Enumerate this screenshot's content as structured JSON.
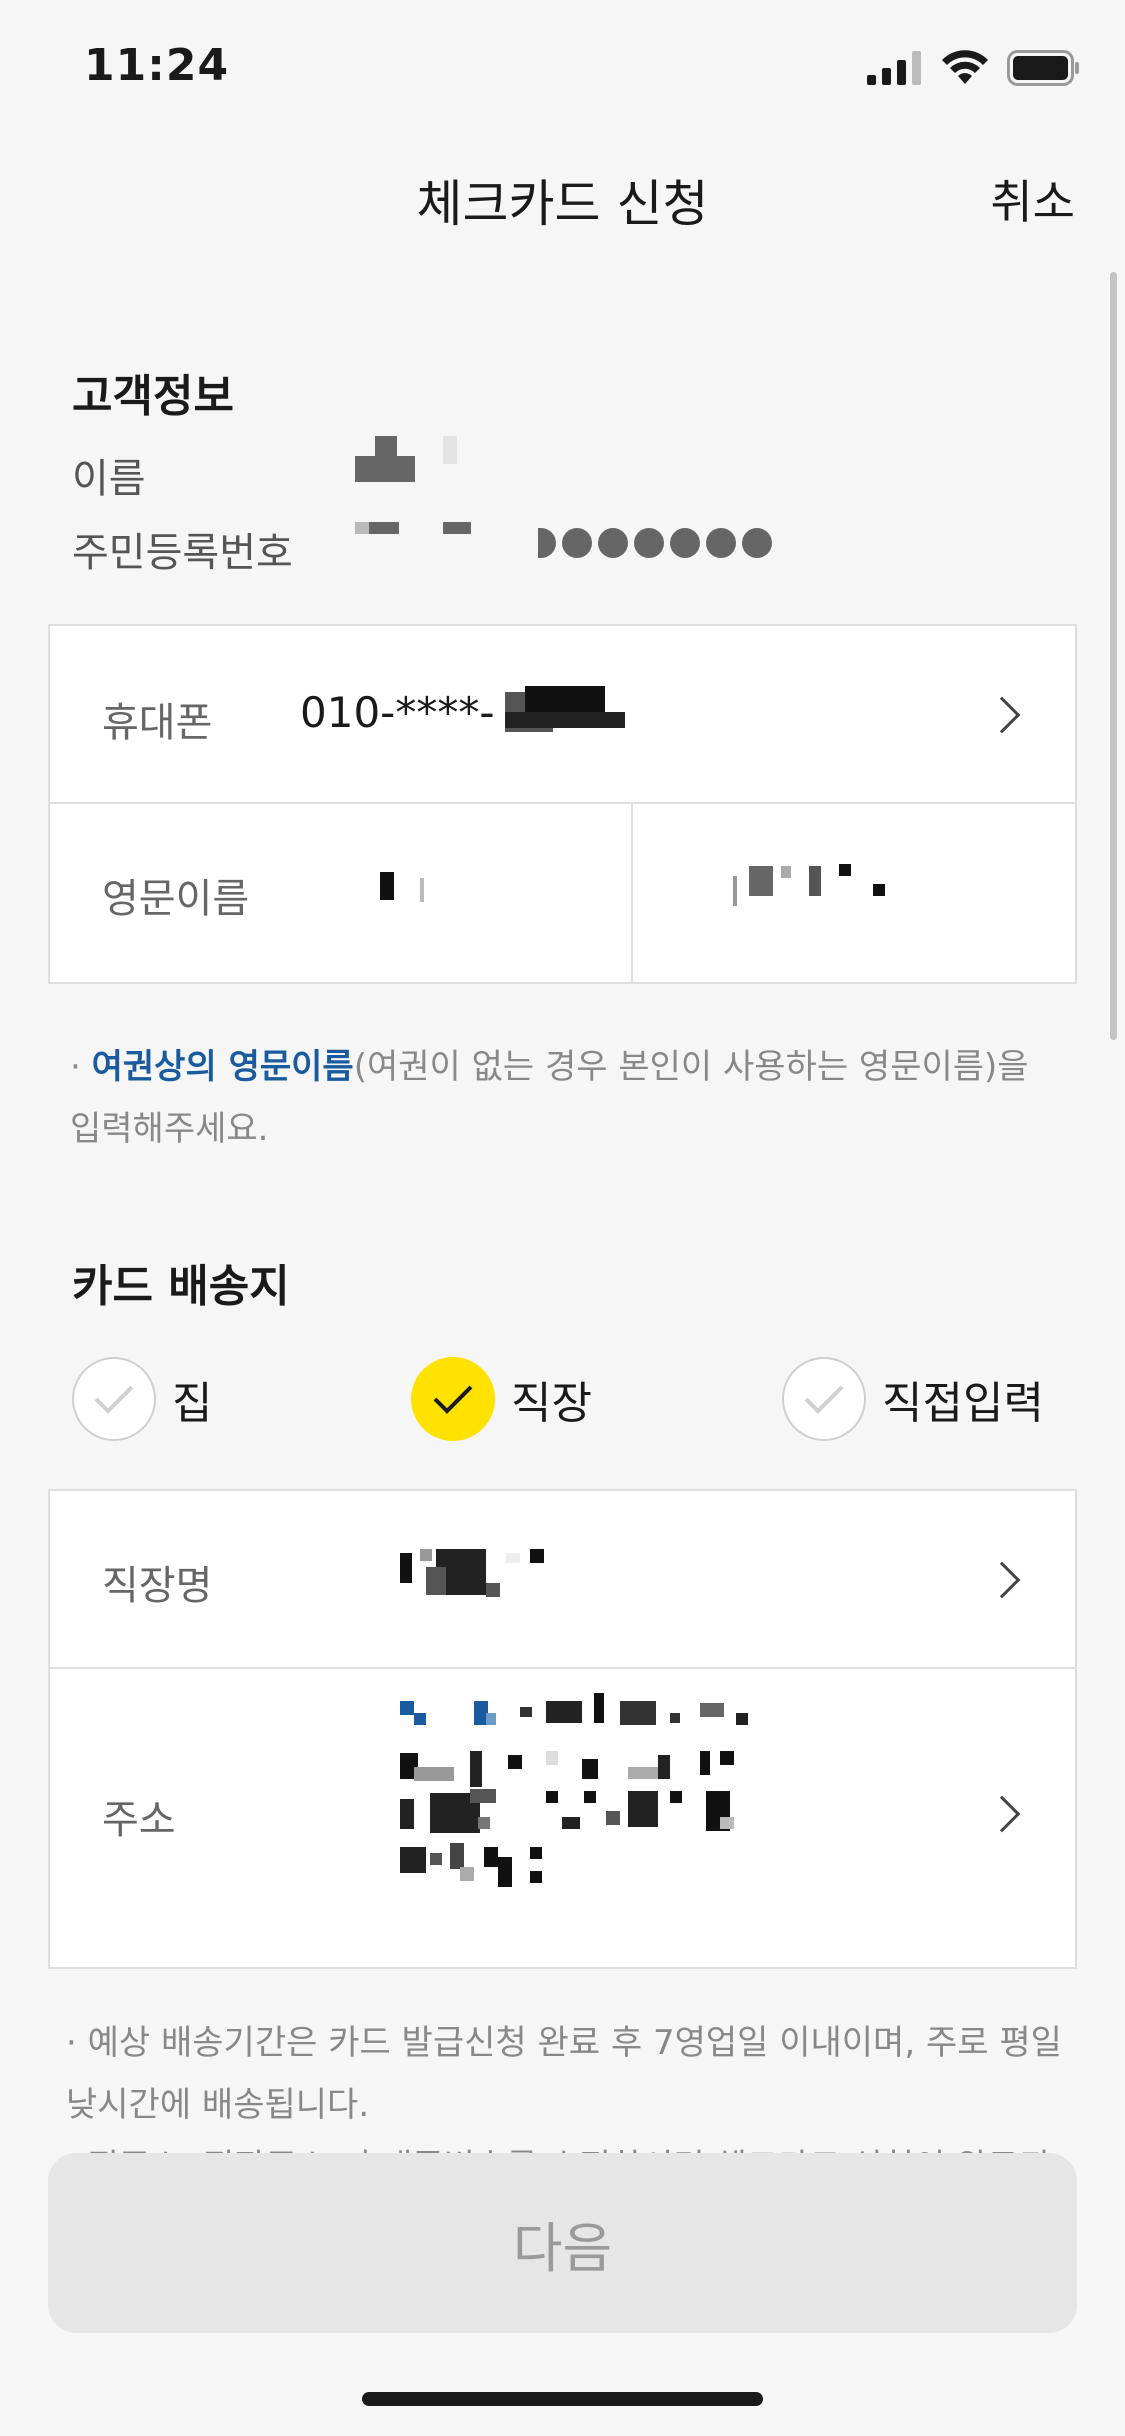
{
  "status": {
    "time": "11:24"
  },
  "header": {
    "title": "체크카드 신청",
    "cancel_label": "취소"
  },
  "customer_info": {
    "section_title": "고객정보",
    "name_label": "이름",
    "rrn_label": "주민등록번호"
  },
  "phone": {
    "label": "휴대폰",
    "value": "010-****-"
  },
  "english_name": {
    "label": "영문이름"
  },
  "english_name_note": {
    "bullet": "·",
    "highlight": "여권상의 영문이름",
    "rest": "(여권이 없는 경우 본인이 사용하는 영문이름)을 입력해주세요."
  },
  "delivery": {
    "section_title": "카드 배송지",
    "options": [
      {
        "label": "집",
        "selected": false
      },
      {
        "label": "직장",
        "selected": true
      },
      {
        "label": "직접입력",
        "selected": false
      }
    ]
  },
  "workplace": {
    "name_label": "직장명",
    "address_label": "주소"
  },
  "delivery_note": {
    "line1": "· 예상 배송기간은 카드 발급신청 완료 후 7영업일 이내이며, 주로 평일 낮시간에 배송됩니다.",
    "line2": "· 집주소, 직장주소, 휴대폰번호를 수정하시면 체크카드 신청이 완료되"
  },
  "footer": {
    "next_label": "다음"
  },
  "colors": {
    "accent_yellow": "#ffe200",
    "link_blue": "#1a5a9e",
    "background": "#f6f6f6"
  }
}
